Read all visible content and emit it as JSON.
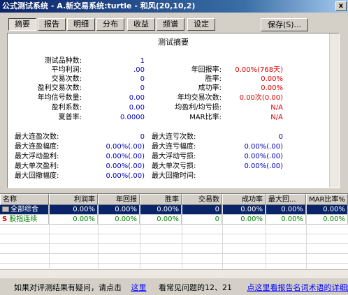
{
  "window": {
    "title": "公式测试系统 - A.新交易系统:turtle - 和风(20,10,2)",
    "close_glyph": "x"
  },
  "tabs": [
    "摘要",
    "报告",
    "明细",
    "分布",
    "收益",
    "频谱",
    "设定"
  ],
  "save_button": "保存(S)...",
  "summary": {
    "title": "测试摘要",
    "left": [
      {
        "label": "测试品种数:",
        "value": "1"
      },
      {
        "label": "平均利润:",
        "value": ".00"
      },
      {
        "label": "交易次数:",
        "value": "0"
      },
      {
        "label": "盈利交易次数:",
        "value": "0"
      },
      {
        "label": "年均信号数量:",
        "value": "0.00"
      },
      {
        "label": "盈利系数:",
        "value": "0.00"
      },
      {
        "label": "夏普率:",
        "value": "0.0000"
      }
    ],
    "right": [
      {
        "label": "年回报率:",
        "value": "0.00%(768天)"
      },
      {
        "label": "胜率:",
        "value": "0.00%"
      },
      {
        "label": "成功率:",
        "value": "0.00%"
      },
      {
        "label": "年均交易次数:",
        "value": "0.00次(0.00)"
      },
      {
        "label": "均盈利/均亏损:",
        "value": "N/A"
      },
      {
        "label": "MAR比率:",
        "value": "N/A"
      }
    ],
    "left2": [
      {
        "label": "最大连盈次数:",
        "value": "0"
      },
      {
        "label": "最大连盈幅度:",
        "value": "0.00%(.00)"
      },
      {
        "label": "最大浮动盈利:",
        "value": "0.00%(.00)"
      },
      {
        "label": "最大单次盈利:",
        "value": "0.00%(.00)"
      },
      {
        "label": "最大回撤幅度:",
        "value": "0.00%(.00)"
      }
    ],
    "right2": [
      {
        "label": "最大连亏次数:",
        "value": "0"
      },
      {
        "label": "最大连亏幅度:",
        "value": "0.00%(.00)"
      },
      {
        "label": "最大浮动亏损:",
        "value": "0.00%(.00)"
      },
      {
        "label": "最大单次亏损:",
        "value": "0.00%(.00)"
      },
      {
        "label": "最大回撤时间:",
        "value": ""
      }
    ]
  },
  "grid": {
    "headers": [
      "名称",
      "利润率",
      "年回报",
      "胜率",
      "交易数",
      "成功率",
      "最大回...",
      "MAR比率%"
    ],
    "rows": [
      {
        "marker": "",
        "cells": [
          "全部综合",
          "0.00%",
          "0.00%",
          "0.00%",
          "0",
          "0.00%",
          "0.00%",
          "0.00%"
        ]
      },
      {
        "marker": "S",
        "cells": [
          "股指连续",
          "0.00%",
          "0.00%",
          "0.00%",
          "0",
          "0.00%",
          "0.00%",
          "0.00%"
        ]
      }
    ]
  },
  "status": {
    "prefix": "如果对评测结果有疑问，请点击",
    "link1": "这里",
    "middle": "看常见问题的12、21",
    "link2": "点这里看报告名词术语的详细解释"
  },
  "colors": {
    "accent": "#0a246a",
    "value_blue": "#0000c0",
    "value_red": "#e00000",
    "green_row": "#008000"
  }
}
